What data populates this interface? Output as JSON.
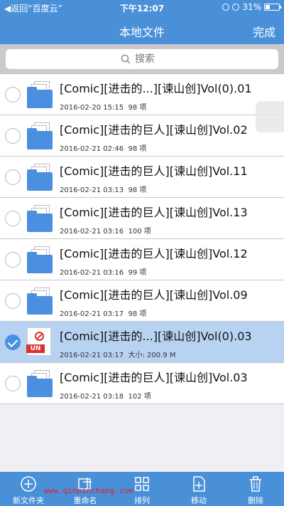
{
  "status_bar": {
    "back": "◀︎返回“百度云”",
    "time": "下午12:07",
    "battery": "31%",
    "battery_level": 0.31
  },
  "nav": {
    "title": "本地文件",
    "done": "完成"
  },
  "search": {
    "placeholder": "搜索"
  },
  "files": [
    {
      "name": "[Comic][进击的...][谏山创]Vol(0).01",
      "date": "2016-02-20 15:15",
      "info": "98 项",
      "selected": false
    },
    {
      "name": "[Comic][进击的巨人][谏山创]Vol.02",
      "date": "2016-02-21 02:46",
      "info": "98 项",
      "selected": false
    },
    {
      "name": "[Comic][进击的巨人][谏山创]Vol.11",
      "date": "2016-02-21 03:13",
      "info": "98 项",
      "selected": false
    },
    {
      "name": "[Comic][进击的巨人][谏山创]Vol.13",
      "date": "2016-02-21 03:16",
      "info": "100 项",
      "selected": false
    },
    {
      "name": "[Comic][进击的巨人][谏山创]Vol.12",
      "date": "2016-02-21 03:16",
      "info": "99 项",
      "selected": false
    },
    {
      "name": "[Comic][进击的巨人][谏山创]Vol.09",
      "date": "2016-02-21 03:17",
      "info": "98 项",
      "selected": false
    },
    {
      "name": "[Comic][进击的...][谏山创]Vol(0).03",
      "date": "2016-02-21 03:17",
      "info": "大小: 200.9 M",
      "selected": true,
      "badge": "UN"
    },
    {
      "name": "[Comic][进击的巨人][谏山创]Vol.03",
      "date": "2016-02-21 03:18",
      "info": "102 项",
      "selected": false
    }
  ],
  "toolbar": {
    "new_folder": "新文件夹",
    "rename": "重命名",
    "sort": "排列",
    "move": "移动",
    "delete": "删除"
  },
  "watermark": "www.qinpinchang.com",
  "colors": {
    "accent": "#4a90d9",
    "selected_row": "#b8d3f2",
    "badge": "#d9312b"
  }
}
